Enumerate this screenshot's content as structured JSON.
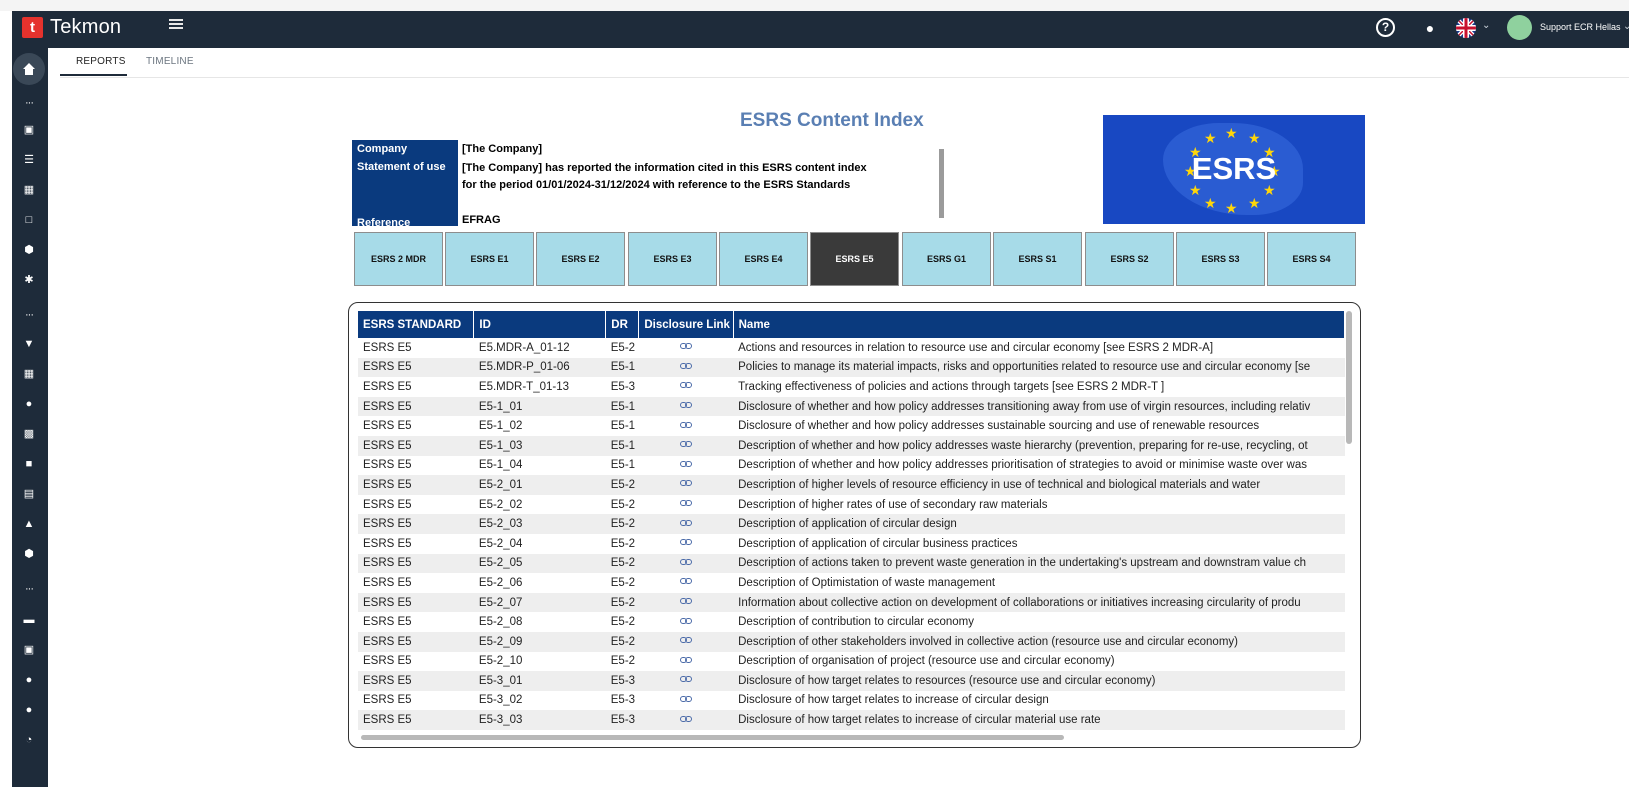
{
  "app": {
    "brand": "Tekmon",
    "user_name": "Support ECR Hellas",
    "icons": [
      "help-icon",
      "bell-icon",
      "uk-flag-icon",
      "hamburger-icon"
    ]
  },
  "tabs": [
    {
      "label": "REPORTS",
      "active": true
    },
    {
      "label": "TIMELINE",
      "active": false
    }
  ],
  "report": {
    "title": "ESRS Content Index",
    "info": {
      "company_label": "Company",
      "company_value": "[The Company]",
      "statement_label": "Statement of use",
      "statement_value": "[The Company] has reported the information cited in this ESRS content index for the period 01/01/2024-31/12/2024 with reference to the ESRS Standards",
      "reference_label": "Reference",
      "reference_value": "EFRAG"
    },
    "flag_text": "ESRS",
    "standards": [
      "ESRS 2 MDR",
      "ESRS E1",
      "ESRS E2",
      "ESRS E3",
      "ESRS E4",
      "ESRS E5",
      "ESRS G1",
      "ESRS S1",
      "ESRS S2",
      "ESRS S3",
      "ESRS S4"
    ],
    "active_standard": "ESRS E5",
    "table": {
      "headers": [
        "ESRS STANDARD",
        "ID",
        "DR",
        "Disclosure Link",
        "Name"
      ],
      "rows": [
        [
          "ESRS E5",
          "E5.MDR-A_01-12",
          "E5-2",
          "Actions and resources in relation to resource use and circular economy [see ESRS 2 MDR-A]"
        ],
        [
          "ESRS E5",
          "E5.MDR-P_01-06",
          "E5-1",
          "Policies to manage its material impacts, risks and opportunities related to resource use and circular economy [se"
        ],
        [
          "ESRS E5",
          "E5.MDR-T_01-13",
          "E5-3",
          "Tracking effectiveness of policies and actions through targets [see ESRS 2 MDR-T ]"
        ],
        [
          "ESRS E5",
          "E5-1_01",
          "E5-1",
          "Disclosure of whether and how policy addresses transitioning away from use of virgin resources, including relativ"
        ],
        [
          "ESRS E5",
          "E5-1_02",
          "E5-1",
          "Disclosure of whether and how policy addresses sustainable sourcing and use of renewable resources"
        ],
        [
          "ESRS E5",
          "E5-1_03",
          "E5-1",
          "Description of whether and how policy addresses waste hierarchy (prevention, preparing for re-use, recycling, ot"
        ],
        [
          "ESRS E5",
          "E5-1_04",
          "E5-1",
          "Description of whether and how policy addresses prioritisation of strategies to avoid or minimise waste over was"
        ],
        [
          "ESRS E5",
          "E5-2_01",
          "E5-2",
          "Description of higher levels of resource efficiency in use of technical and biological materials and water"
        ],
        [
          "ESRS E5",
          "E5-2_02",
          "E5-2",
          "Description of higher rates of use of secondary raw materials"
        ],
        [
          "ESRS E5",
          "E5-2_03",
          "E5-2",
          "Description of application of circular design"
        ],
        [
          "ESRS E5",
          "E5-2_04",
          "E5-2",
          "Description of application of circular business practices"
        ],
        [
          "ESRS E5",
          "E5-2_05",
          "E5-2",
          "Description of actions taken to prevent waste generation in the undertaking's upstream and downstram value ch"
        ],
        [
          "ESRS E5",
          "E5-2_06",
          "E5-2",
          "Description of Optimistation of waste management"
        ],
        [
          "ESRS E5",
          "E5-2_07",
          "E5-2",
          "Information about collective action on development of collaborations or initiatives increasing circularity of produ"
        ],
        [
          "ESRS E5",
          "E5-2_08",
          "E5-2",
          "Description of contribution to circular economy"
        ],
        [
          "ESRS E5",
          "E5-2_09",
          "E5-2",
          "Description of other stakeholders involved in collective action (resource use and circular economy)"
        ],
        [
          "ESRS E5",
          "E5-2_10",
          "E5-2",
          "Description of organisation of project (resource use and circular economy)"
        ],
        [
          "ESRS E5",
          "E5-3_01",
          "E5-3",
          "Disclosure of how target relates to resources (resource use and circular economy)"
        ],
        [
          "ESRS E5",
          "E5-3_02",
          "E5-3",
          "Disclosure of how target relates to increase of circular design"
        ],
        [
          "ESRS E5",
          "E5-3_03",
          "E5-3",
          "Disclosure of how target relates to increase of circular material use rate"
        ]
      ]
    }
  },
  "sidebar": {
    "items": [
      "home-icon",
      "more-icon",
      "checkbox-icon",
      "list-icon",
      "dashboard-icon",
      "folder-icon",
      "cube-icon",
      "settings-icon",
      "more-icon",
      "diamond-icon",
      "calculator-icon",
      "location-icon",
      "building-icon",
      "trash-icon",
      "book-icon",
      "people-icon",
      "box-icon",
      "more-icon",
      "card-icon",
      "document-icon",
      "user-icon",
      "group-icon",
      "pie-icon"
    ]
  }
}
